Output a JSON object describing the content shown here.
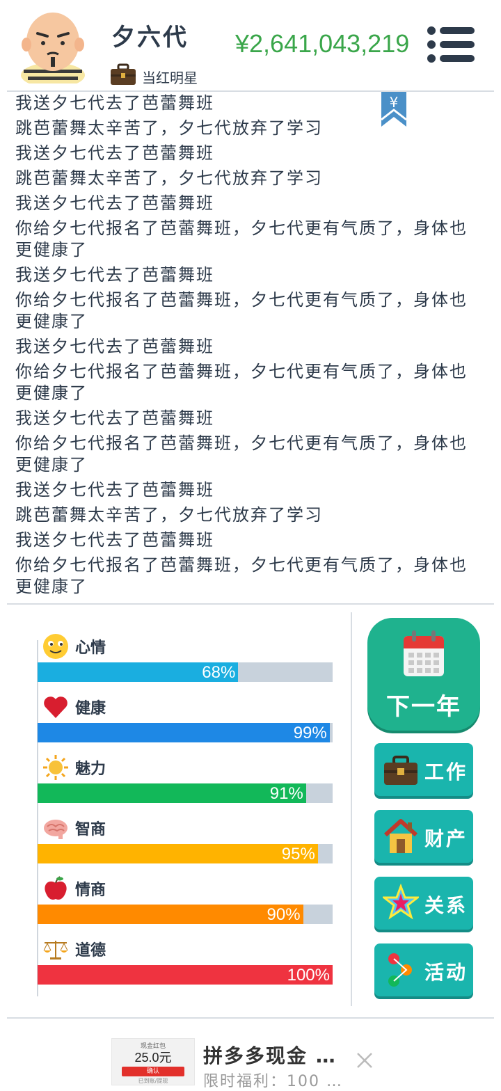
{
  "header": {
    "name": "夕六代",
    "job_label": "当红明星",
    "money": "¥2,641,043,219"
  },
  "log": {
    "lines": [
      "我送夕七代去了芭蕾舞班",
      "跳芭蕾舞太辛苦了，夕七代放弃了学习",
      "我送夕七代去了芭蕾舞班",
      "跳芭蕾舞太辛苦了，夕七代放弃了学习",
      "我送夕七代去了芭蕾舞班",
      "你给夕七代报名了芭蕾舞班，夕七代更有气质了，身体也更健康了",
      "我送夕七代去了芭蕾舞班",
      "你给夕七代报名了芭蕾舞班，夕七代更有气质了，身体也更健康了",
      "我送夕七代去了芭蕾舞班",
      "你给夕七代报名了芭蕾舞班，夕七代更有气质了，身体也更健康了",
      "我送夕七代去了芭蕾舞班",
      "你给夕七代报名了芭蕾舞班，夕七代更有气质了，身体也更健康了",
      "我送夕七代去了芭蕾舞班",
      "跳芭蕾舞太辛苦了，夕七代放弃了学习",
      "我送夕七代去了芭蕾舞班",
      "你给夕七代报名了芭蕾舞班，夕七代更有气质了，身体也更健康了"
    ]
  },
  "stats": [
    {
      "label": "心情",
      "percent": "68%",
      "value": 68,
      "color": "#1aaee0",
      "icon": "smiley-icon"
    },
    {
      "label": "健康",
      "percent": "99%",
      "value": 99,
      "color": "#1e88e5",
      "icon": "heart-icon"
    },
    {
      "label": "魅力",
      "percent": "91%",
      "value": 91,
      "color": "#12b859",
      "icon": "sun-icon"
    },
    {
      "label": "智商",
      "percent": "95%",
      "value": 95,
      "color": "#ffb300",
      "icon": "brain-icon"
    },
    {
      "label": "情商",
      "percent": "90%",
      "value": 90,
      "color": "#ff8a00",
      "icon": "apple-icon"
    },
    {
      "label": "道德",
      "percent": "100%",
      "value": 100,
      "color": "#ef3340",
      "icon": "scales-icon"
    }
  ],
  "actions": {
    "next_year": "下一年",
    "work": "工作",
    "property": "财产",
    "relation": "关系",
    "activity": "活动"
  },
  "ad": {
    "title": "拼多多现金 …",
    "subtitle": "限时福利：100 …",
    "image_top": "现金红包",
    "image_amount": "25.0元",
    "image_button": "确认",
    "image_note": "已到账/提现"
  },
  "colors": {
    "money": "#3aa64a",
    "next_button": "#1fb28e",
    "action_button": "#1ab5ad"
  }
}
